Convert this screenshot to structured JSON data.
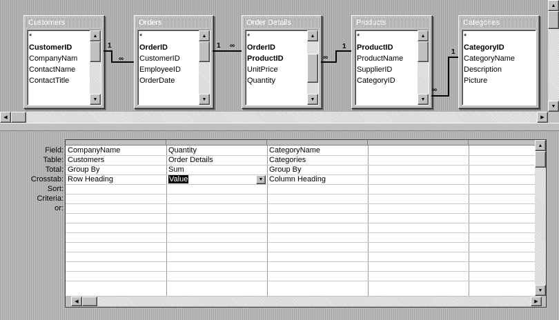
{
  "tables": [
    {
      "title": "Customers",
      "fields": [
        {
          "label": "*",
          "key": false
        },
        {
          "label": "CustomerID",
          "key": true
        },
        {
          "label": "CompanyNam",
          "key": false
        },
        {
          "label": "ContactName",
          "key": false
        },
        {
          "label": "ContactTitle",
          "key": false
        }
      ]
    },
    {
      "title": "Orders",
      "fields": [
        {
          "label": "*",
          "key": false
        },
        {
          "label": "OrderID",
          "key": true
        },
        {
          "label": "CustomerID",
          "key": false
        },
        {
          "label": "EmployeeID",
          "key": false
        },
        {
          "label": "OrderDate",
          "key": false
        }
      ]
    },
    {
      "title": "Order Details",
      "fields": [
        {
          "label": "*",
          "key": false
        },
        {
          "label": "OrderID",
          "key": true
        },
        {
          "label": "ProductID",
          "key": true
        },
        {
          "label": "UnitPrice",
          "key": false
        },
        {
          "label": "Quantity",
          "key": false
        }
      ]
    },
    {
      "title": "Products",
      "fields": [
        {
          "label": "*",
          "key": false
        },
        {
          "label": "ProductID",
          "key": true
        },
        {
          "label": "ProductName",
          "key": false
        },
        {
          "label": "SupplierID",
          "key": false
        },
        {
          "label": "CategoryID",
          "key": false
        }
      ]
    },
    {
      "title": "Categories",
      "fields": [
        {
          "label": "*",
          "key": false
        },
        {
          "label": "CategoryID",
          "key": true
        },
        {
          "label": "CategoryName",
          "key": false
        },
        {
          "label": "Description",
          "key": false
        },
        {
          "label": "Picture",
          "key": false
        }
      ]
    }
  ],
  "joins": {
    "one": "1",
    "many": "∞"
  },
  "grid": {
    "row_labels": {
      "field": "Field:",
      "table": "Table:",
      "total": "Total:",
      "crosstab": "Crosstab:",
      "sort": "Sort:",
      "criteria": "Criteria:",
      "or": "or:"
    },
    "columns": [
      {
        "field": "CompanyName",
        "table": "Customers",
        "total": "Group By",
        "crosstab": "Row Heading"
      },
      {
        "field": "Quantity",
        "table": "Order Details",
        "total": "Sum",
        "crosstab": "Value"
      },
      {
        "field": "CategoryName",
        "table": "Categories",
        "total": "Group By",
        "crosstab": "Column Heading"
      },
      {
        "field": "",
        "table": "",
        "total": "",
        "crosstab": ""
      },
      {
        "field": "",
        "table": "",
        "total": "",
        "crosstab": ""
      }
    ]
  }
}
